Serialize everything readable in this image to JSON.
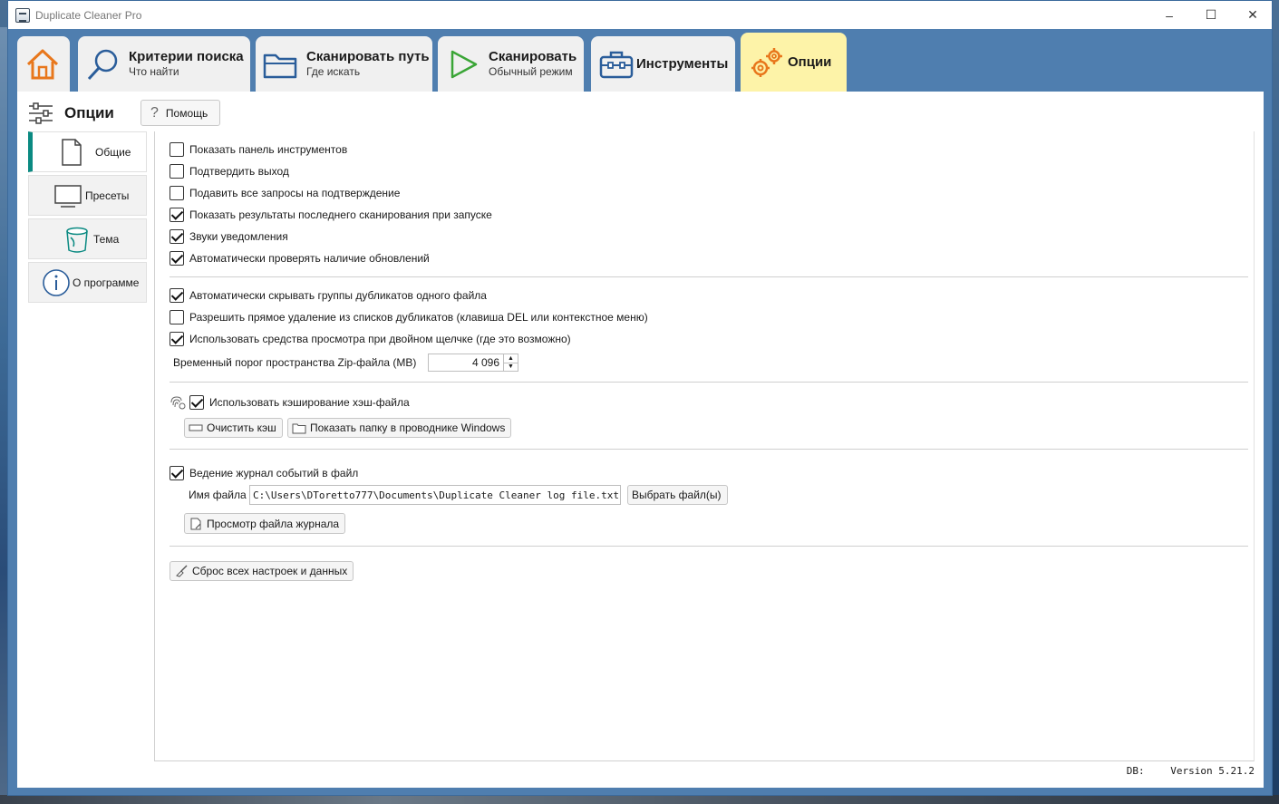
{
  "window": {
    "title": "Duplicate Cleaner Pro",
    "controls": {
      "minimize": "–",
      "maximize": "☐",
      "close": "✕"
    }
  },
  "tabs": [
    {
      "icon": "home-icon"
    },
    {
      "icon": "search-icon",
      "title": "Критерии поиска",
      "subtitle": "Что найти"
    },
    {
      "icon": "folder-icon",
      "title": "Сканировать путь",
      "subtitle": "Где искать"
    },
    {
      "icon": "play-icon",
      "title": "Сканировать",
      "subtitle": "Обычный режим"
    },
    {
      "icon": "toolbox-icon",
      "title": "Инструменты"
    },
    {
      "icon": "gears-icon",
      "title": "Опции"
    }
  ],
  "header": {
    "title": "Опции",
    "help_label": "Помощь"
  },
  "sidenav": [
    {
      "icon": "page-icon",
      "label": "Общие"
    },
    {
      "icon": "monitor-icon",
      "label": "Пресеты"
    },
    {
      "icon": "paint-bucket-icon",
      "label": "Тема"
    },
    {
      "icon": "info-icon",
      "label": "О программе"
    }
  ],
  "options": {
    "show_toolbar": {
      "label": "Показать панель инструментов",
      "checked": false
    },
    "confirm_exit": {
      "label": "Подтвердить выход",
      "checked": false
    },
    "suppress_prompts": {
      "label": "Подавить все запросы на подтверждение",
      "checked": false
    },
    "show_last_results": {
      "label": "Показать результаты последнего сканирования при запуске",
      "checked": true
    },
    "notification_sounds": {
      "label": "Звуки уведомления",
      "checked": true
    },
    "auto_updates": {
      "label": "Автоматически проверять наличие обновлений",
      "checked": true
    },
    "hide_single_file_groups": {
      "label": "Автоматически скрывать группы дубликатов одного файла",
      "checked": true
    },
    "allow_direct_delete": {
      "label": "Разрешить прямое удаление из списков дубликатов (клавиша DEL или контекстное меню)",
      "checked": false
    },
    "double_click_viewers": {
      "label": "Использовать средства просмотра при двойном щелчке (где это возможно)",
      "checked": true
    },
    "zip_threshold": {
      "label": "Временный порог пространства Zip-файла (MB)",
      "value": "4 096"
    },
    "hash_cache": {
      "label": "Использовать кэширование хэш-файла",
      "checked": true
    },
    "clear_cache_label": "Очистить кэш",
    "show_folder_label": "Показать папку в проводнике Windows",
    "log_to_file": {
      "label": "Ведение журнал событий в файл",
      "checked": true
    },
    "file_name_label": "Имя файла",
    "file_name_value": "C:\\Users\\DToretto777\\Documents\\Duplicate Cleaner log file.txt",
    "choose_files_label": "Выбрать файл(ы)",
    "view_log_label": "Просмотр файла журнала",
    "reset_label": "Сброс всех настроек и данных"
  },
  "status": {
    "db": "DB:",
    "version": "Version 5.21.2"
  }
}
